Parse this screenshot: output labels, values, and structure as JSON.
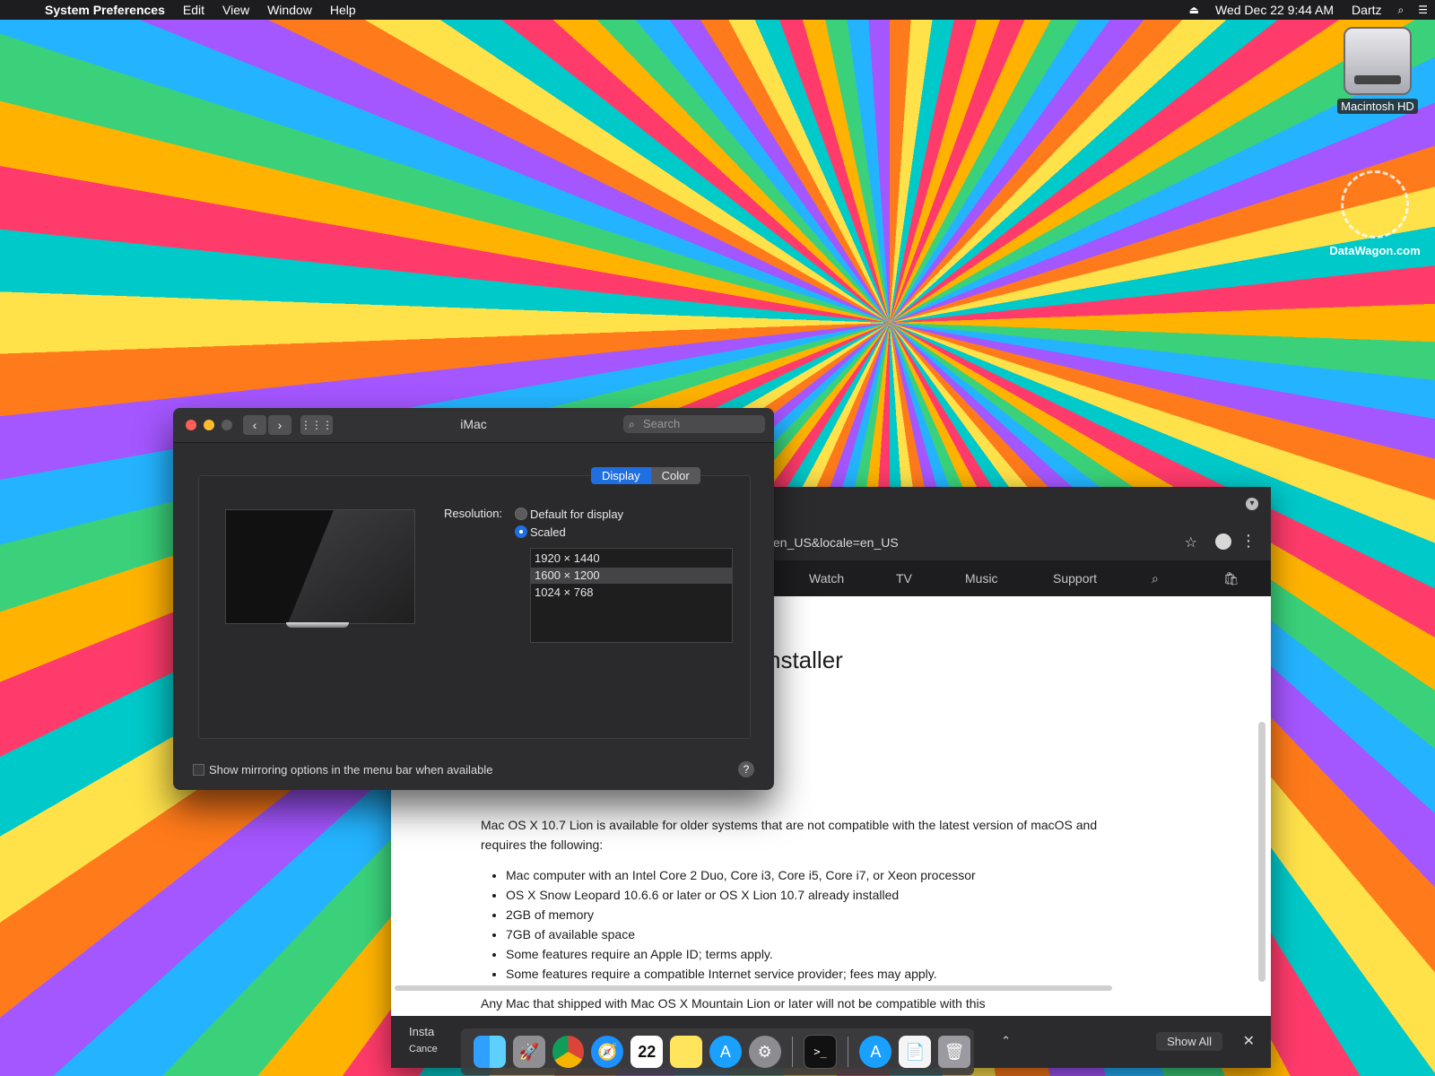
{
  "menubar": {
    "app_name": "System Preferences",
    "items": [
      "Edit",
      "View",
      "Window",
      "Help"
    ],
    "datetime": "Wed Dec 22  9:44 AM",
    "user": "Dartz"
  },
  "desktop": {
    "disk_label": "Macintosh HD",
    "watermark_label": "DataWagon.com"
  },
  "browser": {
    "url_fragment": "en_US&locale=en_US",
    "nav_items": [
      "Watch",
      "TV",
      "Music",
      "Support"
    ],
    "heading_fragment": "nstaller",
    "paragraph": "Mac OS X 10.7 Lion is available for older systems that are not compatible with the latest version of macOS and requires the following:",
    "requirements": [
      "Mac computer with an Intel Core 2 Duo, Core i3, Core i5, Core i7, or Xeon processor",
      "OS X Snow Leopard 10.6.6 or later or OS X Lion 10.7 already installed",
      "2GB of memory",
      "7GB of available space",
      "Some features require an Apple ID; terms apply.",
      "Some features require a compatible Internet service provider; fees may apply."
    ],
    "trailing_text": "Any Mac that shipped with Mac OS X Mountain Lion or later will not be compatible with this",
    "download_name": "Insta",
    "download_sub": "Cance",
    "show_all": "Show All"
  },
  "prefs": {
    "title": "iMac",
    "search_placeholder": "Search",
    "tabs": [
      "Display",
      "Color"
    ],
    "resolution_label": "Resolution:",
    "options": [
      "Default for display",
      "Scaled"
    ],
    "resolutions": [
      "1920 × 1440",
      "1600 × 1200",
      "1024 × 768"
    ],
    "mirroring_label": "Show mirroring options in the menu bar when available",
    "help": "?"
  },
  "dock": {
    "calendar_day": "22",
    "terminal_prompt": ">_"
  }
}
